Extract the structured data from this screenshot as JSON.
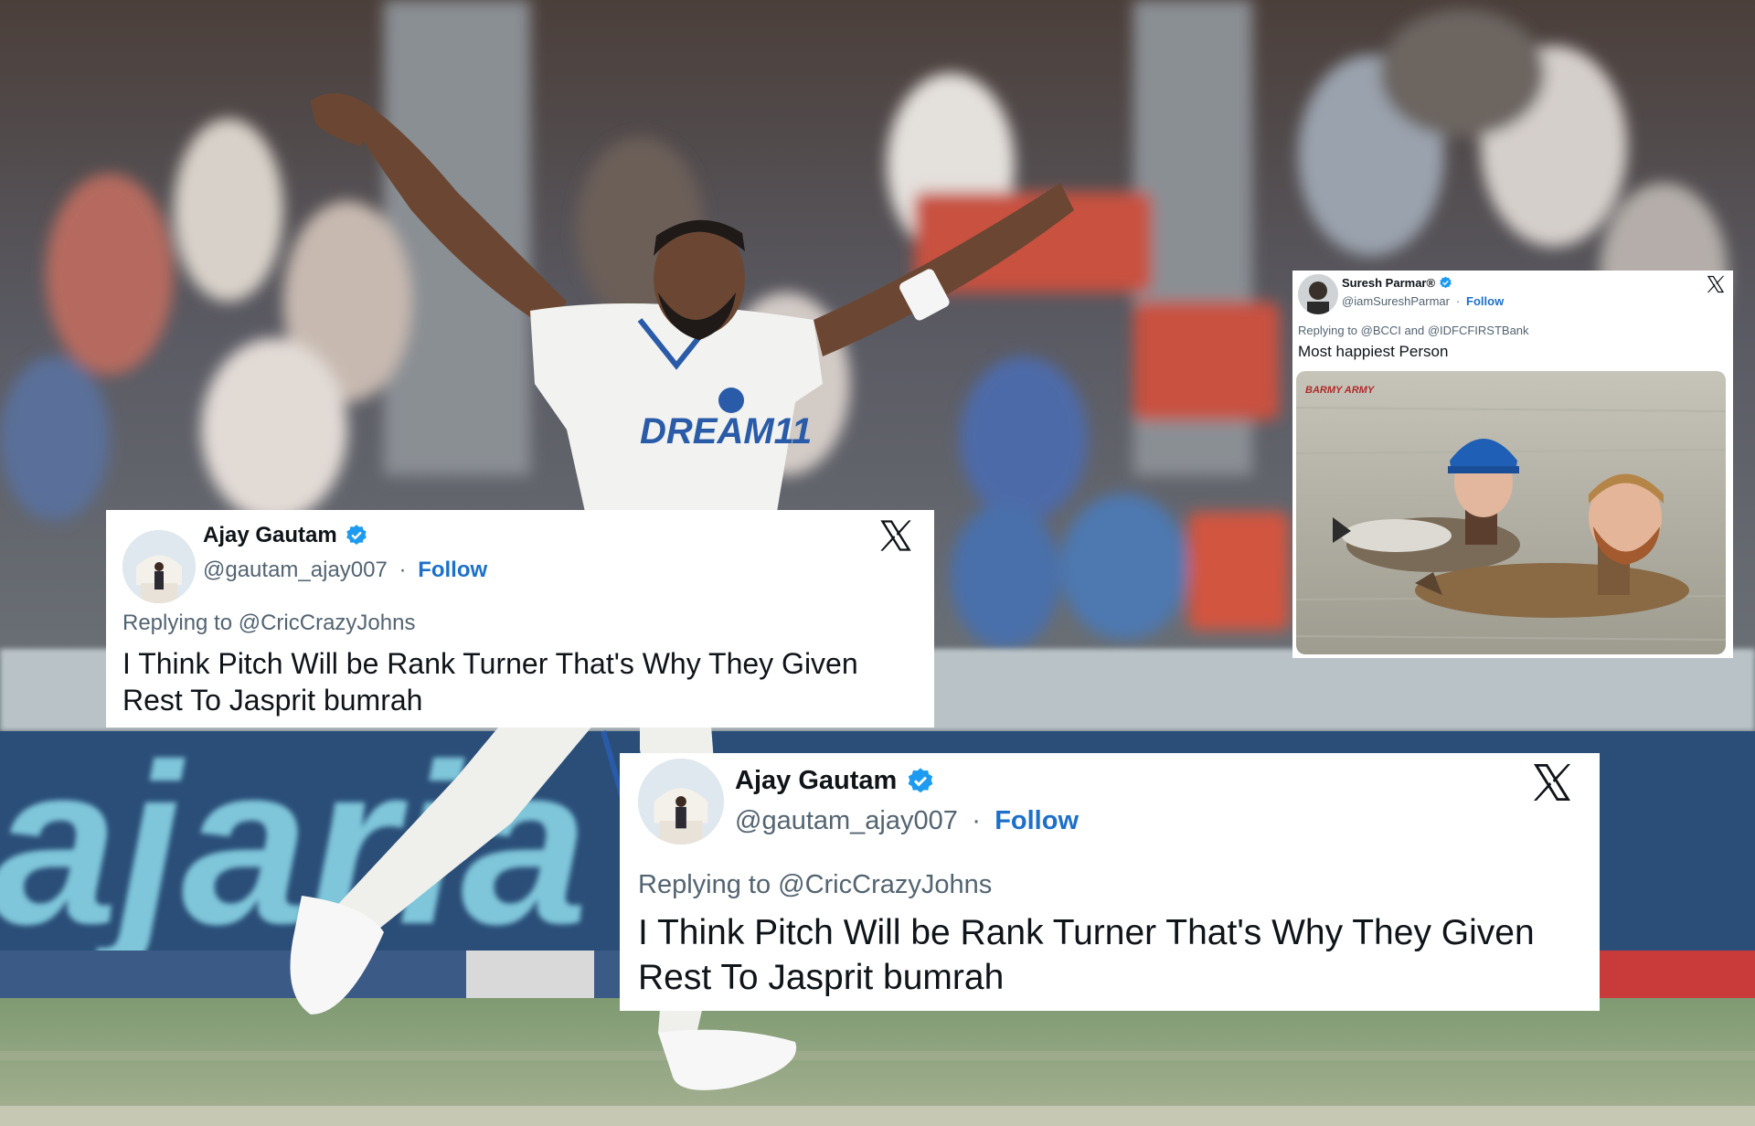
{
  "background": {
    "jersey_text": "DREAM11",
    "stadium_banner_text": "ajaria"
  },
  "tweets": [
    {
      "name": "Ajay Gautam",
      "handle": "@gautam_ajay007",
      "separator": "·",
      "follow": "Follow",
      "replying_to": "Replying to @CricCrazyJohns",
      "text": "I Think Pitch Will be Rank Turner That's Why They Given Rest To Jasprit bumrah"
    },
    {
      "name": "Ajay Gautam",
      "handle": "@gautam_ajay007",
      "separator": "·",
      "follow": "Follow",
      "replying_to": "Replying to @CricCrazyJohns",
      "text": "I Think Pitch Will be Rank Turner That's Why They Given Rest To Jasprit bumrah"
    },
    {
      "name": "Suresh Parmar®",
      "handle": "@iamSureshParmar",
      "separator": "·",
      "follow": "Follow",
      "replying_to": "Replying to @BCCI and @IDFCFIRSTBank",
      "text": "Most happiest Person",
      "media_logo": "BARMY ARMY"
    }
  ],
  "colors": {
    "verified_badge": "#1d9bf0",
    "follow_link": "#1d70c9",
    "text_primary": "#0f1419",
    "text_secondary": "#536471"
  },
  "icons": [
    "verified-badge-icon",
    "x-logo-icon"
  ]
}
